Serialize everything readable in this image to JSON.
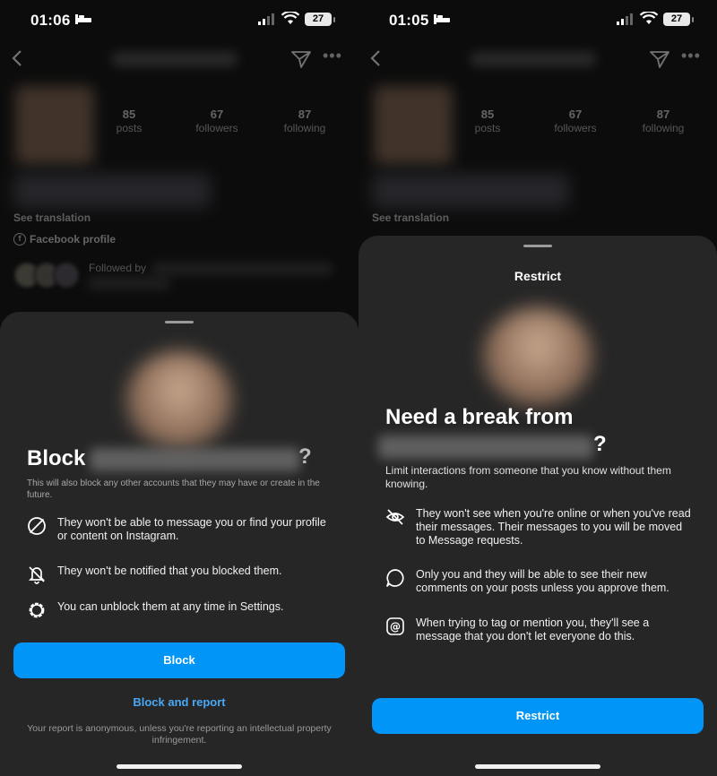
{
  "left": {
    "status": {
      "time": "01:06",
      "battery": "27"
    },
    "profile": {
      "stats": [
        {
          "num": "85",
          "label": "posts"
        },
        {
          "num": "67",
          "label": "followers"
        },
        {
          "num": "87",
          "label": "following"
        }
      ],
      "see_translation": "See translation",
      "facebook_profile": "Facebook profile",
      "followed_by": "Followed by"
    },
    "sheet": {
      "heading": "Block",
      "heading_suffix": "?",
      "note": "This will also block any other accounts that they may have or create in the future.",
      "items": [
        {
          "icon": "message-off-icon",
          "text": "They won't be able to message you or find your profile or content on Instagram."
        },
        {
          "icon": "bell-off-icon",
          "text": "They won't be notified that you blocked them."
        },
        {
          "icon": "gear-icon",
          "text": "You can unblock them at any time in Settings."
        }
      ],
      "primary_button": "Block",
      "secondary_link": "Block and report",
      "footnote": "Your report is anonymous, unless you're reporting an intellectual property infringement."
    }
  },
  "right": {
    "status": {
      "time": "01:05",
      "battery": "27"
    },
    "profile": {
      "stats": [
        {
          "num": "85",
          "label": "posts"
        },
        {
          "num": "67",
          "label": "followers"
        },
        {
          "num": "87",
          "label": "following"
        }
      ],
      "see_translation": "See translation"
    },
    "sheet": {
      "title": "Restrict",
      "heading_line1": "Need a break from",
      "heading_suffix": "?",
      "subtitle": "Limit interactions from someone that you know without them knowing.",
      "items": [
        {
          "icon": "eye-off-icon",
          "text": "They won't see when you're online or when you've read their messages. Their messages to you will be moved to Message requests."
        },
        {
          "icon": "comment-icon",
          "text": "Only you and they will be able to see their new comments on your posts unless you approve them."
        },
        {
          "icon": "at-sign-icon",
          "text": "When trying to tag or mention you, they'll see a message that you don't let everyone do this."
        }
      ],
      "primary_button": "Restrict"
    }
  }
}
